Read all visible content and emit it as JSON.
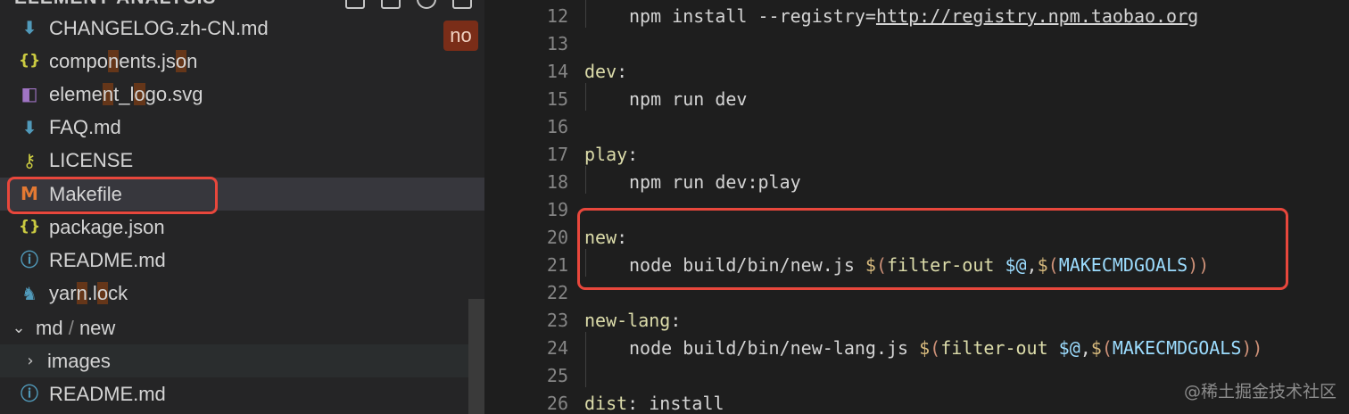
{
  "sidebar": {
    "header": "ELEMENT-ANALYSIS",
    "badge": "no",
    "files": [
      {
        "icon": "markdown-download-icon",
        "glyph": "⬇",
        "color": "#519aba",
        "parts": [
          {
            "t": "CHANGELOG.zh-CN.md",
            "m": false
          }
        ]
      },
      {
        "icon": "json-braces-icon",
        "glyph": "{}",
        "color": "#cbcb41",
        "parts": [
          {
            "t": "compo",
            "m": false
          },
          {
            "t": "n",
            "m": true
          },
          {
            "t": "ents.js",
            "m": false
          },
          {
            "t": "o",
            "m": true
          },
          {
            "t": "n",
            "m": false
          }
        ]
      },
      {
        "icon": "svg-file-icon",
        "glyph": "◧",
        "color": "#a074c4",
        "parts": [
          {
            "t": "eleme",
            "m": false
          },
          {
            "t": "n",
            "m": true
          },
          {
            "t": "t_l",
            "m": false
          },
          {
            "t": "o",
            "m": true
          },
          {
            "t": "go.svg",
            "m": false
          }
        ]
      },
      {
        "icon": "markdown-download-icon",
        "glyph": "⬇",
        "color": "#519aba",
        "parts": [
          {
            "t": "FAQ.md",
            "m": false
          }
        ]
      },
      {
        "icon": "license-key-icon",
        "glyph": "⚷",
        "color": "#cbcb41",
        "parts": [
          {
            "t": "LICENSE",
            "m": false
          }
        ]
      },
      {
        "icon": "makefile-m-icon",
        "glyph": "M",
        "color": "#e37933",
        "parts": [
          {
            "t": "Makefile",
            "m": false
          }
        ],
        "selected": true
      },
      {
        "icon": "json-braces-icon",
        "glyph": "{}",
        "color": "#cbcb41",
        "parts": [
          {
            "t": "package.json",
            "m": false
          }
        ]
      },
      {
        "icon": "info-circle-icon",
        "glyph": "ⓘ",
        "color": "#519aba",
        "parts": [
          {
            "t": "README.md",
            "m": false
          }
        ]
      },
      {
        "icon": "yarn-cat-icon",
        "glyph": "♞",
        "color": "#519aba",
        "parts": [
          {
            "t": "yar",
            "m": false
          },
          {
            "t": "n",
            "m": true
          },
          {
            "t": ".l",
            "m": false
          },
          {
            "t": "o",
            "m": true
          },
          {
            "t": "ck",
            "m": false
          }
        ]
      }
    ],
    "folder_md": {
      "chevron": "⌄",
      "path_a": "md",
      "sep": "/",
      "path_b": "new"
    },
    "folder_images": {
      "chevron": "›",
      "label": "images"
    },
    "readme2": {
      "icon": "info-circle-icon",
      "glyph": "ⓘ",
      "color": "#519aba",
      "label": "README.md"
    }
  },
  "editor": {
    "lines": [
      {
        "n": "12",
        "indent": true,
        "tokens": [
          {
            "t": "npm install --registry=",
            "c": "txt"
          },
          {
            "t": "http://registry.npm.taobao.org",
            "c": "url"
          }
        ]
      },
      {
        "n": "13",
        "indent": false,
        "tokens": []
      },
      {
        "n": "14",
        "indent": false,
        "tokens": [
          {
            "t": "dev",
            "c": "tgt"
          },
          {
            "t": ":",
            "c": "txt"
          }
        ]
      },
      {
        "n": "15",
        "indent": true,
        "tokens": [
          {
            "t": "npm run dev",
            "c": "txt"
          }
        ]
      },
      {
        "n": "16",
        "indent": false,
        "tokens": []
      },
      {
        "n": "17",
        "indent": false,
        "tokens": [
          {
            "t": "play",
            "c": "tgt"
          },
          {
            "t": ":",
            "c": "txt"
          }
        ]
      },
      {
        "n": "18",
        "indent": true,
        "tokens": [
          {
            "t": "npm run dev:play",
            "c": "txt"
          }
        ]
      },
      {
        "n": "19",
        "indent": false,
        "tokens": []
      },
      {
        "n": "20",
        "indent": false,
        "tokens": [
          {
            "t": "new",
            "c": "tgt"
          },
          {
            "t": ":",
            "c": "txt"
          }
        ]
      },
      {
        "n": "21",
        "indent": true,
        "tokens": [
          {
            "t": "node build/bin/new.js ",
            "c": "txt"
          },
          {
            "t": "$",
            "c": "dollar"
          },
          {
            "t": "(",
            "c": "br"
          },
          {
            "t": "filter-out ",
            "c": "fn"
          },
          {
            "t": "$@",
            "c": "var"
          },
          {
            "t": ",",
            "c": "txt"
          },
          {
            "t": "$",
            "c": "dollar"
          },
          {
            "t": "(",
            "c": "br"
          },
          {
            "t": "MAKECMDGOALS",
            "c": "var"
          },
          {
            "t": "))",
            "c": "br"
          }
        ]
      },
      {
        "n": "22",
        "indent": false,
        "tokens": []
      },
      {
        "n": "23",
        "indent": false,
        "tokens": [
          {
            "t": "new-lang",
            "c": "tgt"
          },
          {
            "t": ":",
            "c": "txt"
          }
        ]
      },
      {
        "n": "24",
        "indent": true,
        "tokens": [
          {
            "t": "node build/bin/new-lang.js ",
            "c": "txt"
          },
          {
            "t": "$",
            "c": "dollar"
          },
          {
            "t": "(",
            "c": "br"
          },
          {
            "t": "filter-out ",
            "c": "fn"
          },
          {
            "t": "$@",
            "c": "var"
          },
          {
            "t": ",",
            "c": "txt"
          },
          {
            "t": "$",
            "c": "dollar"
          },
          {
            "t": "(",
            "c": "br"
          },
          {
            "t": "MAKECMDGOALS",
            "c": "var"
          },
          {
            "t": "))",
            "c": "br"
          }
        ]
      },
      {
        "n": "25",
        "indent": false,
        "tokens": []
      },
      {
        "n": "26",
        "indent": false,
        "tokens": [
          {
            "t": "dist",
            "c": "tgt"
          },
          {
            "t": ": install",
            "c": "txt"
          }
        ]
      }
    ]
  },
  "watermark": "@稀土掘金技术社区"
}
